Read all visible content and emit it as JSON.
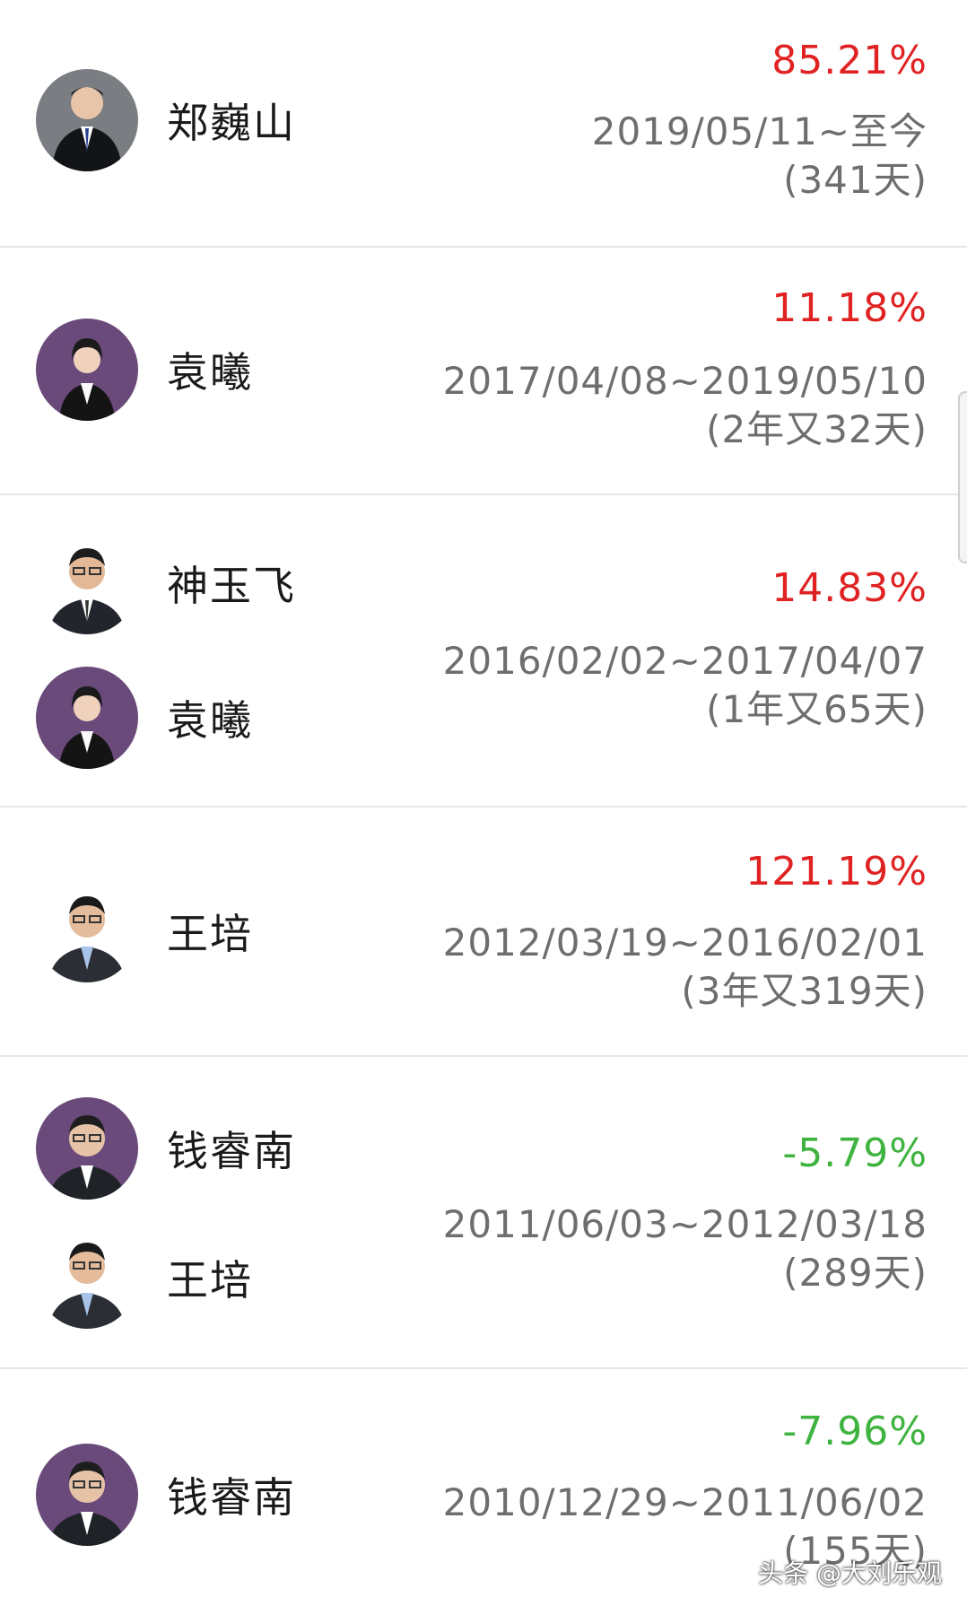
{
  "rows": [
    {
      "managers": [
        {
          "name": "郑巍山",
          "avatar": "man-dark-suit-avatar"
        }
      ],
      "return": "85.21%",
      "trend": "up",
      "date_range": "2019/05/11~至今",
      "duration": "(341天)"
    },
    {
      "managers": [
        {
          "name": "袁曦",
          "avatar": "woman-purple-bg-avatar"
        }
      ],
      "return": "11.18%",
      "trend": "up",
      "date_range": "2017/04/08~2019/05/10",
      "duration": "(2年又32天)"
    },
    {
      "managers": [
        {
          "name": "神玉飞",
          "avatar": "man-glasses-avatar"
        },
        {
          "name": "袁曦",
          "avatar": "woman-purple-bg-avatar"
        }
      ],
      "return": "14.83%",
      "trend": "up",
      "date_range": "2016/02/02~2017/04/07",
      "duration": "(1年又65天)"
    },
    {
      "managers": [
        {
          "name": "王培",
          "avatar": "man-glasses-avatar"
        }
      ],
      "return": "121.19%",
      "trend": "up",
      "date_range": "2012/03/19~2016/02/01",
      "duration": "(3年又319天)"
    },
    {
      "managers": [
        {
          "name": "钱睿南",
          "avatar": "man-glasses-purple-bg-avatar"
        },
        {
          "name": "王培",
          "avatar": "man-glasses-avatar"
        }
      ],
      "return": "-5.79%",
      "trend": "down",
      "date_range": "2011/06/03~2012/03/18",
      "duration": "(289天)"
    },
    {
      "managers": [
        {
          "name": "钱睿南",
          "avatar": "man-glasses-purple-bg-avatar"
        }
      ],
      "return": "-7.96%",
      "trend": "down",
      "date_range": "2010/12/29~2011/06/02",
      "duration": "(155天)"
    }
  ],
  "colors": {
    "up": "#e02222",
    "down": "#3fb33f",
    "text_gray": "#6e6e6e",
    "divider": "#e6e6e6"
  },
  "watermark": "头条 @大刘乐观"
}
